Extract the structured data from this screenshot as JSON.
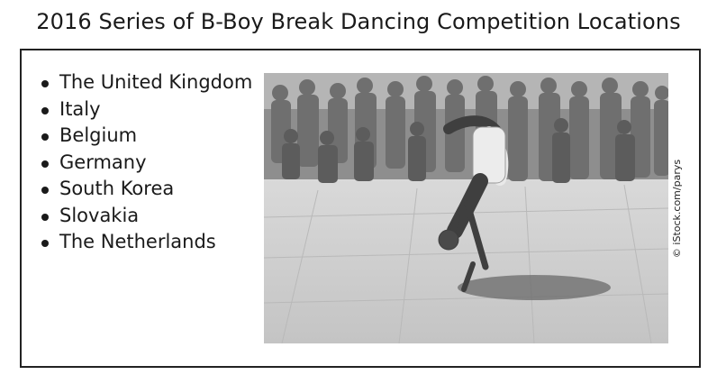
{
  "title": "2016 Series of B-Boy Break Dancing Competition Locations",
  "locations": [
    "The United Kingdom",
    "Italy",
    "Belgium",
    "Germany",
    "South Korea",
    "Slovakia",
    "The Netherlands"
  ],
  "photo": {
    "credit": "© iStock.com/parys"
  }
}
